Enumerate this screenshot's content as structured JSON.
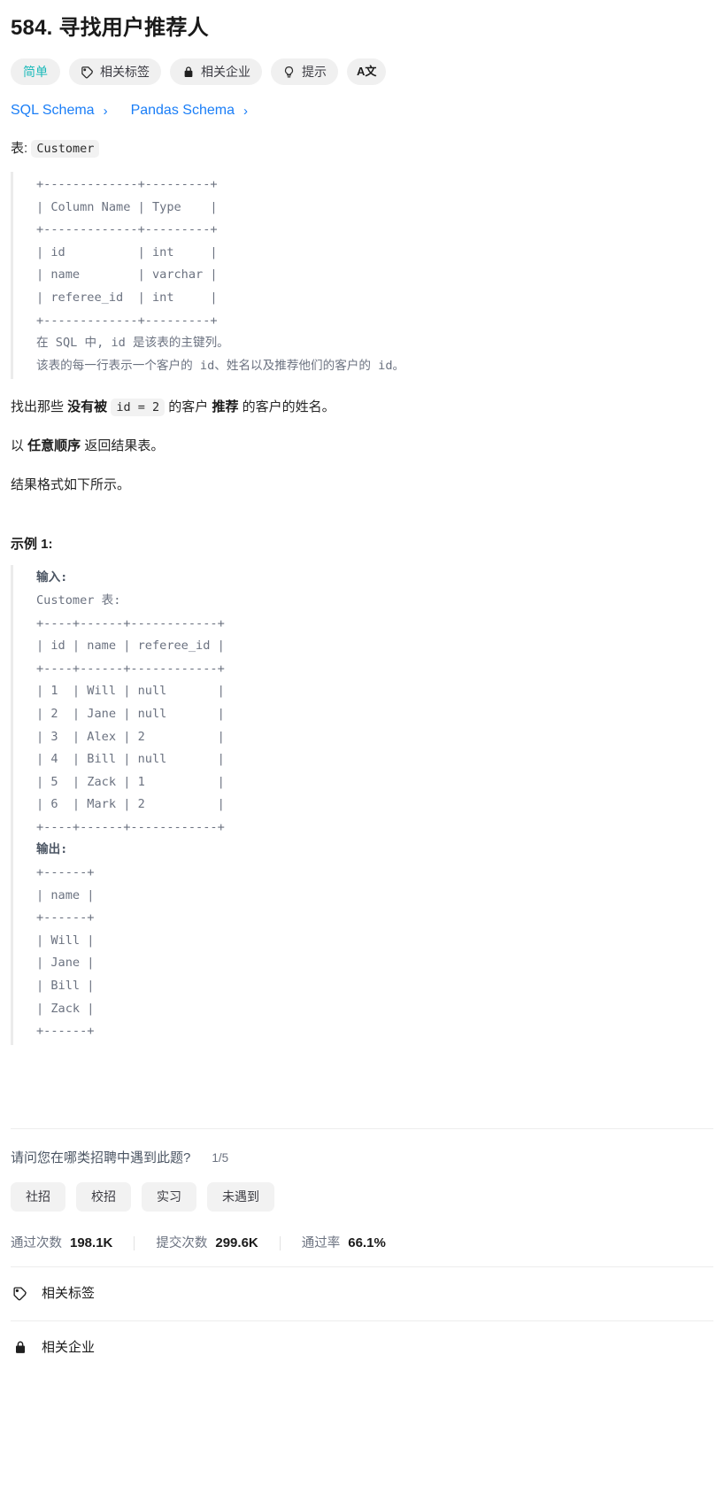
{
  "problem": {
    "title": "584. 寻找用户推荐人"
  },
  "badges": [
    {
      "label": "简单",
      "icon": "",
      "kind": "difficulty",
      "name": "difficulty-badge"
    },
    {
      "label": "相关标签",
      "icon": "tag-icon",
      "kind": "normal",
      "name": "related-tags-button"
    },
    {
      "label": "相关企业",
      "icon": "lock-icon",
      "kind": "normal",
      "name": "related-companies-button"
    },
    {
      "label": "提示",
      "icon": "bulb-icon",
      "kind": "normal",
      "name": "hints-button"
    },
    {
      "label": "A文",
      "icon": "translate-icon",
      "kind": "translate",
      "name": "translate-button"
    }
  ],
  "schema_links": [
    {
      "label": "SQL Schema",
      "chevron": "›"
    },
    {
      "label": "Pandas Schema",
      "chevron": "›"
    }
  ],
  "description": {
    "table_intro_prefix": "表: ",
    "table_name": "Customer",
    "schema_block": "+-------------+---------+\n| Column Name | Type    |\n+-------------+---------+\n| id          | int     |\n| name        | varchar |\n| referee_id  | int     |\n+-------------+---------+\n在 SQL 中, id 是该表的主键列。\n该表的每一行表示一个客户的 id、姓名以及推荐他们的客户的 id。",
    "task_p1_a": "找出那些 ",
    "task_p1_b": "没有被",
    "task_p1_code": "id = 2",
    "task_p1_c": " 的客户 ",
    "task_p1_d": "推荐",
    "task_p1_e": " 的客户的姓名。",
    "order_a": "以 ",
    "order_b": "任意顺序",
    "order_c": " 返回结果表。",
    "format_note": "结果格式如下所示。"
  },
  "example": {
    "heading": "示例 1:",
    "input_label": "输入:",
    "input_table_caption": "Customer 表:",
    "input_block": "+----+------+------------+\n| id | name | referee_id |\n+----+------+------------+\n| 1  | Will | null       |\n| 2  | Jane | null       |\n| 3  | Alex | 2          |\n| 4  | Bill | null       |\n| 5  | Zack | 1          |\n| 6  | Mark | 2          |\n+----+------+------------+",
    "output_label": "输出:",
    "output_block": "+------+\n| name |\n+------+\n| Will |\n| Jane |\n| Bill |\n| Zack |\n+------+"
  },
  "survey": {
    "question": "请问您在哪类招聘中遇到此题?",
    "counter": "1/5",
    "options": [
      "社招",
      "校招",
      "实习",
      "未遇到"
    ]
  },
  "stats": [
    {
      "label": "通过次数",
      "value": "198.1K"
    },
    {
      "label": "提交次数",
      "value": "299.6K"
    },
    {
      "label": "通过率",
      "value": "66.1%"
    }
  ],
  "footer_rows": [
    {
      "label": "相关标签",
      "icon": "tag-icon"
    },
    {
      "label": "相关企业",
      "icon": "lock-icon"
    }
  ],
  "colors": {
    "difficulty": "#1cbaba",
    "link": "#1a7ef7",
    "text": "#262626",
    "muted": "#6b7280",
    "chip_bg": "#f2f2f2"
  }
}
